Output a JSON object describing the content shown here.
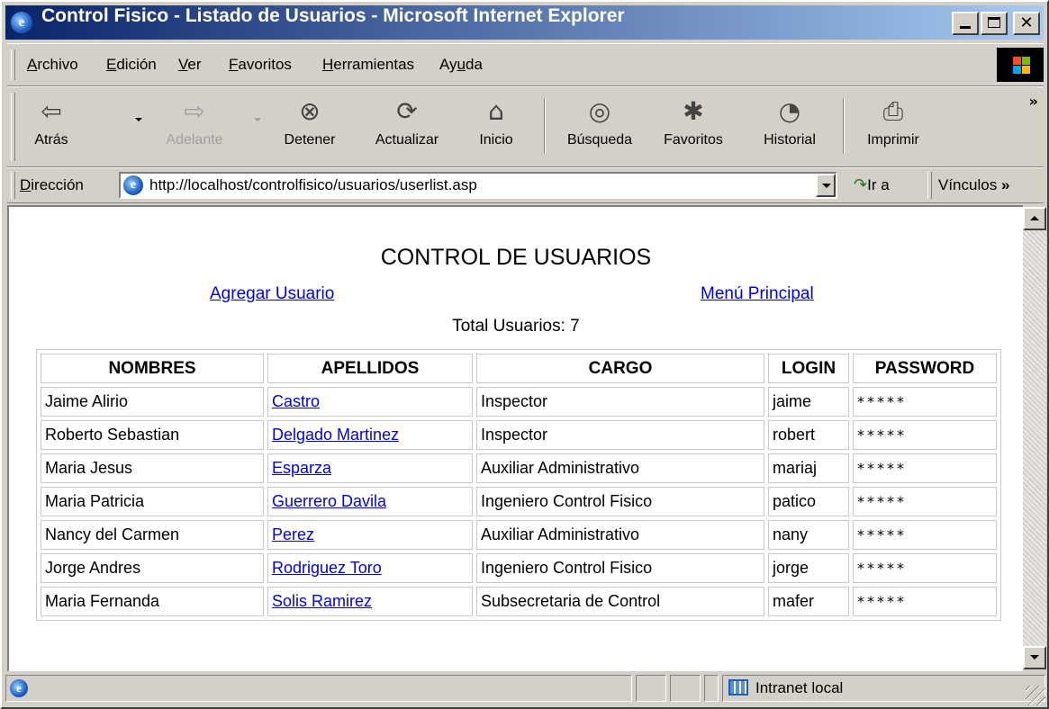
{
  "window": {
    "title": "Control Fisico - Listado de Usuarios - Microsoft Internet Explorer",
    "app_icon_glyph": "e",
    "min_icon": "minimize-icon",
    "max_icon": "maximize-icon",
    "close_glyph": "✕"
  },
  "menu": {
    "items": [
      {
        "label": "Archivo",
        "accel": "A",
        "rest": "rchivo"
      },
      {
        "label": "Edición",
        "accel": "E",
        "rest": "dición"
      },
      {
        "label": "Ver",
        "accel": "V",
        "rest": "er"
      },
      {
        "label": "Favoritos",
        "accel": "F",
        "rest": "avoritos"
      },
      {
        "label": "Herramientas",
        "accel": "H",
        "rest": "erramientas"
      },
      {
        "label": "Ayuda",
        "pre": "Ay",
        "accel": "u",
        "rest": "da"
      }
    ]
  },
  "toolbar": {
    "back": {
      "label": "Atrás",
      "glyph": "⇦"
    },
    "forward": {
      "label": "Adelante",
      "glyph": "⇨"
    },
    "stop": {
      "label": "Detener",
      "glyph": "⊗"
    },
    "refresh": {
      "label": "Actualizar",
      "glyph": "⟳"
    },
    "home": {
      "label": "Inicio",
      "glyph": "⌂"
    },
    "search": {
      "label": "Búsqueda",
      "glyph": "◎"
    },
    "favorites": {
      "label": "Favoritos",
      "glyph": "✱"
    },
    "history": {
      "label": "Historial",
      "glyph": "◔"
    },
    "print": {
      "label": "Imprimir",
      "glyph": "⎙"
    },
    "more_glyph": "»"
  },
  "address": {
    "label_accel": "D",
    "label_rest": "irección",
    "url": "http://localhost/controlfisico/usuarios/userlist.asp",
    "go_glyph": "↷",
    "go_label": "Ir a",
    "links_label": "Vínculos",
    "links_more": "»"
  },
  "page": {
    "title": "CONTROL DE USUARIOS",
    "add_user_link": "Agregar Usuario",
    "main_menu_link": "Menú Principal",
    "total_label": "Total Usuarios: 7"
  },
  "table": {
    "headers": [
      "NOMBRES",
      "APELLIDOS",
      "CARGO",
      "LOGIN",
      "PASSWORD"
    ],
    "rows": [
      {
        "nombres": "Jaime Alirio",
        "apellidos": "Castro",
        "cargo": "Inspector",
        "login": "jaime",
        "password": "*****"
      },
      {
        "nombres": "Roberto Sebastian",
        "apellidos": "Delgado Martinez",
        "cargo": "Inspector",
        "login": "robert",
        "password": "*****"
      },
      {
        "nombres": "Maria Jesus",
        "apellidos": "Esparza",
        "cargo": "Auxiliar Administrativo",
        "login": "mariaj",
        "password": "*****"
      },
      {
        "nombres": "Maria Patricia",
        "apellidos": "Guerrero Davila",
        "cargo": "Ingeniero Control Fisico",
        "login": "patico",
        "password": "*****"
      },
      {
        "nombres": "Nancy del Carmen",
        "apellidos": "Perez",
        "cargo": "Auxiliar Administrativo",
        "login": "nany",
        "password": "*****"
      },
      {
        "nombres": "Jorge Andres",
        "apellidos": "Rodriguez Toro",
        "cargo": "Ingeniero Control Fisico",
        "login": "jorge",
        "password": "*****"
      },
      {
        "nombres": "Maria Fernanda",
        "apellidos": "Solis Ramirez",
        "cargo": "Subsecretaria de Control",
        "login": "mafer",
        "password": "*****"
      }
    ]
  },
  "status": {
    "zone": "Intranet local"
  },
  "colors": {
    "titlebar_start": "#0a246a",
    "titlebar_end": "#a6caf0",
    "link": "#0000ee",
    "chrome": "#d4d0c8"
  }
}
